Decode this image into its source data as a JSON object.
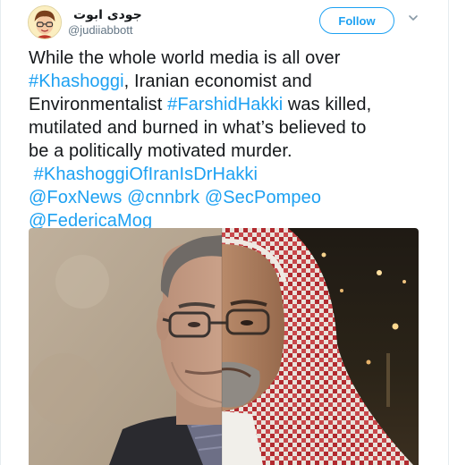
{
  "user": {
    "display_name": "جودی ابوت",
    "handle": "@judiiabbott"
  },
  "actions": {
    "follow_label": "Follow",
    "more_icon": "chevron-down-icon"
  },
  "tweet": {
    "line1": "While the whole world media is all over",
    "line2_tag": "#Khashoggi",
    "line2_rest": ", Iranian economist and",
    "line3_pre": "Environmentalist ",
    "line3_tag": "#FarshidHakki",
    "line3_rest": " was killed,",
    "line4": "mutilated and burned in what’s believed to",
    "line5": "be a politically motivated murder.",
    "tag3": "#KhashoggiOfIranIsDrHakki",
    "mention1": "@FoxNews",
    "mention2": "@cnnbrk",
    "mention3": "@SecPompeo",
    "mention4": "@FedericaMog"
  },
  "colors": {
    "link": "#1da1f2",
    "text": "#14171a",
    "secondary": "#657786"
  }
}
